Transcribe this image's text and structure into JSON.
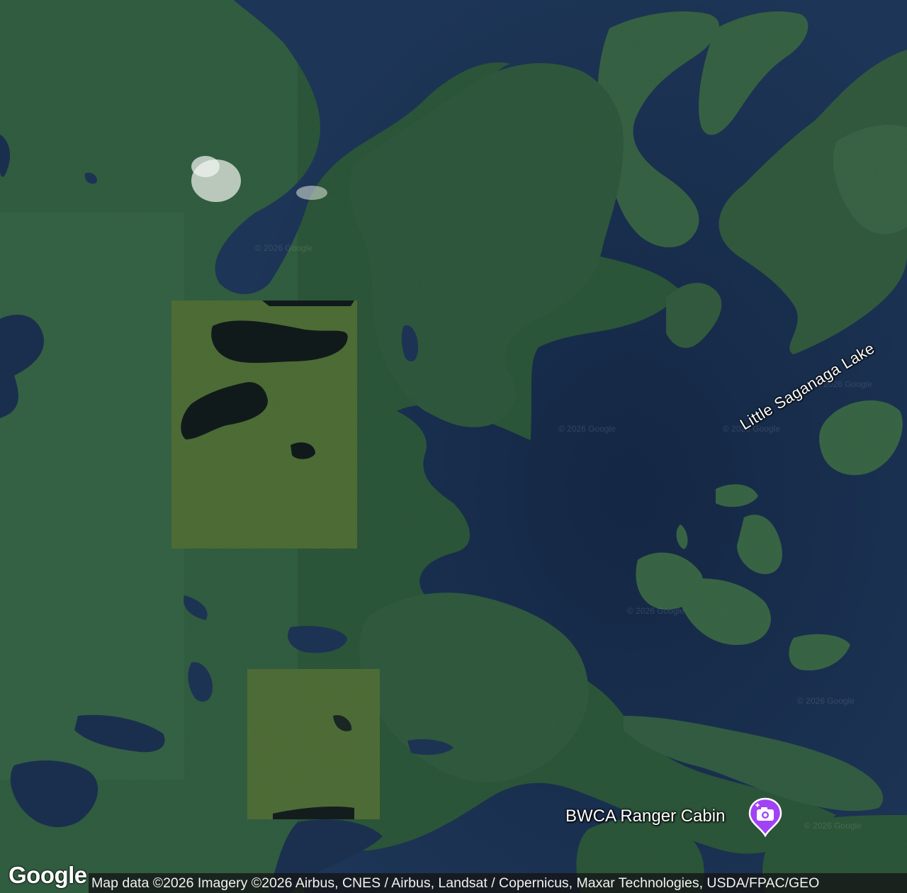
{
  "map": {
    "lake_label": "Little Saganaga Lake",
    "watermark": "© 2026 Google",
    "poi": {
      "name": "BWCA Ranger Cabin",
      "icon": "camera-icon",
      "pin_color": "#a142f4"
    },
    "logo": "Google",
    "attribution": "Map data ©2026 Imagery ©2026 Airbus, CNES / Airbus, Landsat / Copernicus, Maxar Technologies, USDA/FPAC/GEO"
  }
}
